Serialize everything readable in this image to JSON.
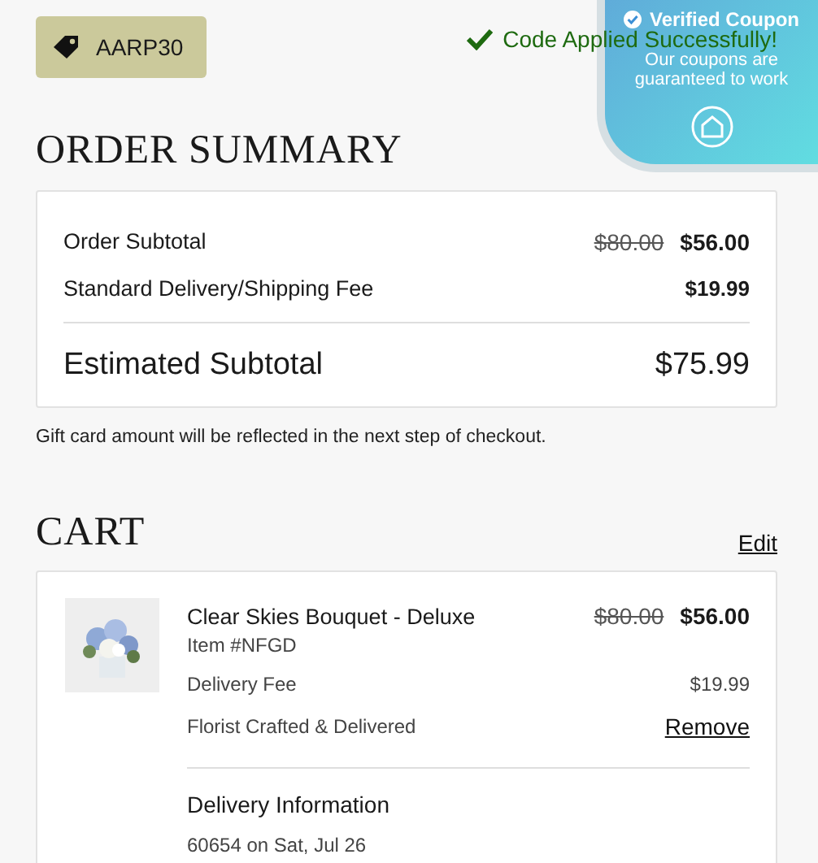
{
  "coupon": {
    "code": "AARP30"
  },
  "status": {
    "message": "Code Applied Successfully!"
  },
  "verified_badge": {
    "title": "Verified Coupon",
    "text": "Our coupons are guaranteed to work"
  },
  "order_summary": {
    "title": "ORDER SUMMARY",
    "rows": [
      {
        "label": "Order Subtotal",
        "old_price": "$80.00",
        "price": "$56.00"
      },
      {
        "label": "Standard Delivery/Shipping Fee",
        "price": "$19.99"
      }
    ],
    "total": {
      "label": "Estimated Subtotal",
      "price": "$75.99"
    }
  },
  "note": "Gift card amount will be reflected in the next step of checkout.",
  "cart": {
    "title": "CART",
    "edit": "Edit",
    "item": {
      "kind": "picture",
      "name": "Clear Skies Bouquet - Deluxe",
      "old_price": "$80.00",
      "price": "$56.00",
      "sku": "Item #NFGD",
      "fee_label": "Delivery Fee",
      "fee": "$19.99",
      "fulfillment": "Florist Crafted & Delivered",
      "remove": "Remove"
    },
    "delivery": {
      "title": "Delivery Information",
      "detail": "60654 on Sat, Jul 26"
    }
  }
}
